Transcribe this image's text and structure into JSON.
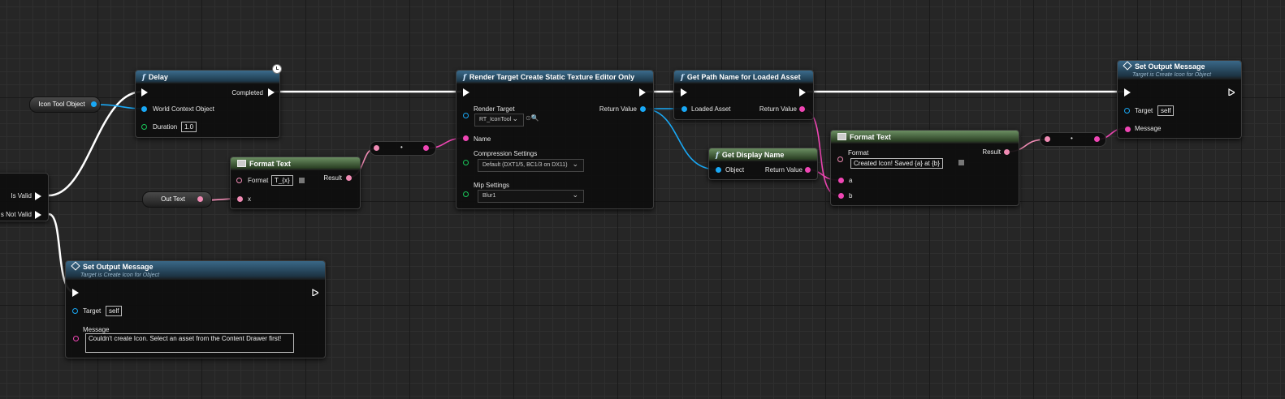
{
  "variables": {
    "icon_tool_object": "Icon Tool Object",
    "out_text": "Out Text"
  },
  "branch": {
    "is_valid": "Is Valid",
    "is_not_valid": "s Not Valid"
  },
  "delay": {
    "title": "Delay",
    "completed": "Completed",
    "world_context": "World Context Object",
    "duration_label": "Duration",
    "duration_value": "1.0"
  },
  "format_text_1": {
    "title": "Format Text",
    "format_label": "Format",
    "format_value": "T_{x}",
    "result": "Result",
    "x": "x"
  },
  "render_target": {
    "title": "Render Target Create Static Texture Editor Only",
    "render_target_label": "Render Target",
    "render_target_value": "RT_IconTool",
    "return_value": "Return Value",
    "name": "Name",
    "compression_label": "Compression Settings",
    "compression_value": "Default (DXT1/5, BC1/3 on DX11)",
    "mip_label": "Mip Settings",
    "mip_value": "Blur1"
  },
  "get_path": {
    "title": "Get Path Name for Loaded Asset",
    "loaded_asset": "Loaded Asset",
    "return_value": "Return Value"
  },
  "get_display_name": {
    "title": "Get Display Name",
    "object": "Object",
    "return_value": "Return Value"
  },
  "format_text_2": {
    "title": "Format Text",
    "format_label": "Format",
    "format_value": "Created Icon!  Saved {a} at {b}",
    "result": "Result",
    "a": "a",
    "b": "b"
  },
  "set_output_1": {
    "title": "Set Output Message",
    "subtitle": "Target is Create Icon for Object",
    "target_label": "Target",
    "target_value": "self",
    "message_label": "Message"
  },
  "set_output_2": {
    "title": "Set Output Message",
    "subtitle": "Target is Create Icon for Object",
    "target_label": "Target",
    "target_value": "self",
    "message_label": "Message",
    "message_value": "Couldn't create Icon.  Select an asset from the Content Drawer first!"
  },
  "colors": {
    "exec": "#ffffff",
    "object_pin": "#19a8f5",
    "text_pin": "#ef46b4",
    "struct_pin": "#f08bb4",
    "enum_pin": "#19c85a",
    "function_header": "#3b6c8c",
    "pure_header": "#6b8e62"
  }
}
